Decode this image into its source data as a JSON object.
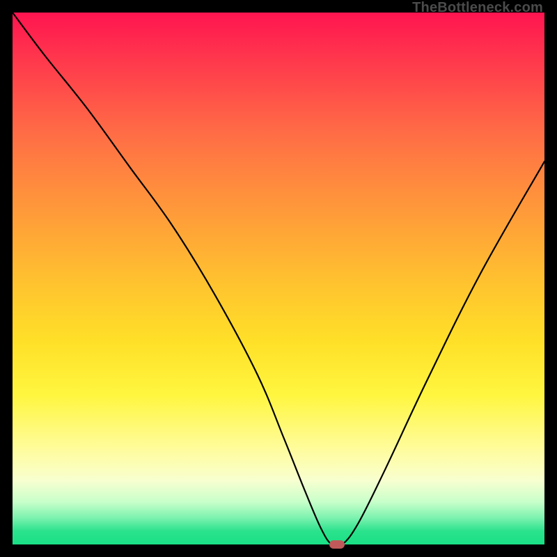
{
  "watermark": "TheBottleneck.com",
  "chart_data": {
    "type": "line",
    "title": "",
    "xlabel": "",
    "ylabel": "",
    "xlim": [
      0,
      100
    ],
    "ylim": [
      0,
      100
    ],
    "background": {
      "type": "vertical-gradient",
      "stops": [
        {
          "pos": 0,
          "color": "#ff1450"
        },
        {
          "pos": 50,
          "color": "#ffc62e"
        },
        {
          "pos": 82,
          "color": "#fffc9c"
        },
        {
          "pos": 100,
          "color": "#19e085"
        }
      ]
    },
    "series": [
      {
        "name": "bottleneck-curve",
        "x": [
          0,
          6,
          14,
          22,
          30,
          38,
          46,
          51,
          55,
          58,
          60,
          62,
          65,
          70,
          78,
          88,
          100
        ],
        "y": [
          100,
          92,
          82,
          71,
          60,
          47,
          32,
          20,
          10,
          3,
          0,
          0,
          4,
          14,
          31,
          51,
          72
        ]
      }
    ],
    "marker": {
      "x": 61,
      "y": 0,
      "color": "#c05a5a"
    }
  }
}
